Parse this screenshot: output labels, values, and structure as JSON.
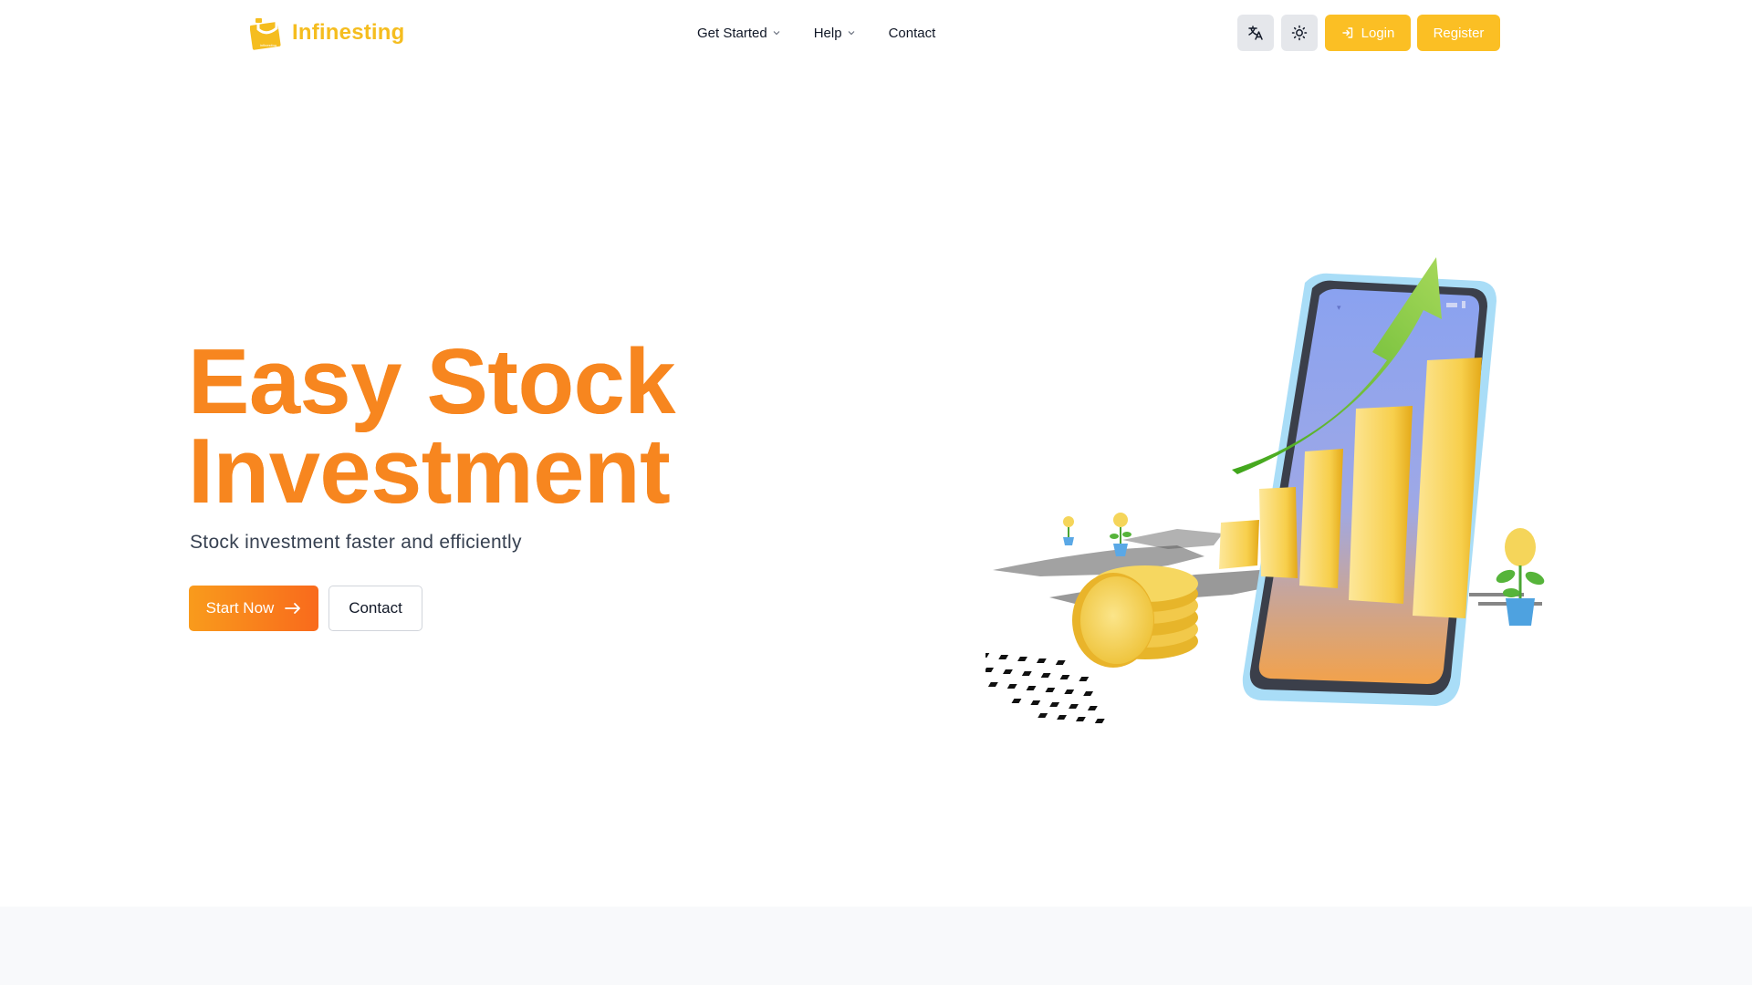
{
  "brand": {
    "name": "Infinesting",
    "color": "#f5bd1f",
    "logo_icon": "phone-logo-icon"
  },
  "nav": {
    "items": [
      {
        "label": "Get Started",
        "dropdown": true
      },
      {
        "label": "Help",
        "dropdown": true
      },
      {
        "label": "Contact",
        "dropdown": false
      }
    ]
  },
  "header_actions": {
    "translate_icon": "translate-icon",
    "theme_icon": "sun-icon",
    "login_label": "Login",
    "register_label": "Register"
  },
  "hero": {
    "title_line1": "Easy Stock",
    "title_line2": "Investment",
    "subtitle": "Stock investment faster and efficiently",
    "primary_cta": "Start Now",
    "secondary_cta": "Contact"
  },
  "colors": {
    "accent_yellow": "#fbbf24",
    "accent_orange": "#f7861f",
    "icon_button_bg": "#e5e7eb"
  }
}
